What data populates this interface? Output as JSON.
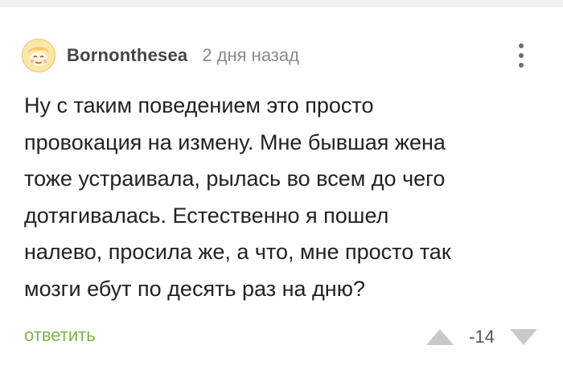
{
  "comment": {
    "author": "Bornonthesea",
    "time_ago": "2 дня назад",
    "avatar_icon": "cartoon-face-avatar-icon",
    "more_icon": "vertical-dots-icon",
    "body_lines": [
      "Ну с таким поведением это просто",
      "провокация на измену. Мне бывшая жена",
      "тоже устраивала, рылась во всем до чего",
      "дотягивалась. Естественно я пошел",
      "налево, просила же, а что, мне просто так",
      "мозги ебут по десять раз на дню?"
    ],
    "reply_label": "ответить",
    "rating": "-14",
    "vote_up_icon": "triangle-up-icon",
    "vote_down_icon": "triangle-down-icon"
  },
  "colors": {
    "reply_link": "#7db34a",
    "vote_arrows": "#c9c9c9",
    "username": "#444444",
    "timestamp": "#8a8a8a",
    "avatar_background": "#fbe7a8"
  }
}
